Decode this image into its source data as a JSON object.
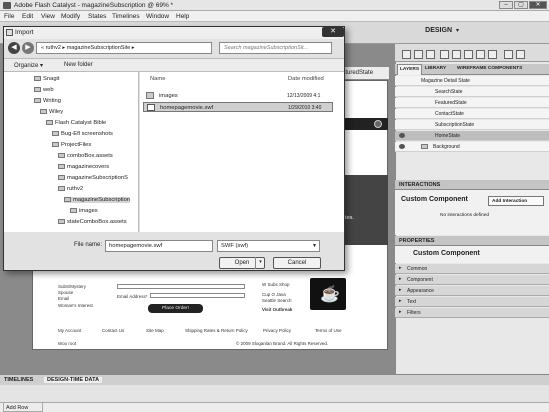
{
  "app": {
    "title": "Adobe Flash Catalyst - magazineSubscription @ 69% *",
    "window_buttons": [
      "–",
      "▢",
      "✕"
    ]
  },
  "menu": [
    "File",
    "Edit",
    "View",
    "Modify",
    "States",
    "Timelines",
    "Window",
    "Help"
  ],
  "toolbar": {
    "workspace": "DESIGN",
    "chevron": "▾"
  },
  "stage": {
    "featured_tab": "FeaturedState",
    "dark_panel_text": "ates.",
    "site": {
      "left_text": [
        "SubS/Mystery",
        "Spouse",
        "Email",
        "Woman's Interest"
      ],
      "email_label": "Email Address*",
      "place_order": "Place Order!",
      "right_text": [
        "W Subs Shop",
        "Cup O Java",
        "Seattle Search",
        "Visit Outbreak"
      ],
      "footer_links": [
        "My Account",
        "Contact Us",
        "Site Map",
        "Shipping Rates & Return Policy",
        "Privacy Policy",
        "Terms of Use"
      ],
      "footer_left": "Woo root",
      "copyright": "© 2009 Sloganlan Brand. All Rights Reserved."
    }
  },
  "timelines": {
    "tab1": "TIMELINES",
    "tab2": "DESIGN-TIME DATA",
    "add_row": "Add Row"
  },
  "layers": {
    "tabs": [
      "LAYERS",
      "LIBRARY",
      "WIREFRAME COMPONENTS"
    ],
    "rows": [
      {
        "label": "Magazine Detail State",
        "indent": 2,
        "eye": false,
        "selected": false
      },
      {
        "label": "SearchState",
        "indent": 3,
        "eye": false,
        "selected": false
      },
      {
        "label": "FeaturedState",
        "indent": 3,
        "eye": false,
        "selected": false
      },
      {
        "label": "ContactState",
        "indent": 3,
        "eye": false,
        "selected": false
      },
      {
        "label": "SubscriptionState",
        "indent": 3,
        "eye": false,
        "selected": false
      },
      {
        "label": "HomeState",
        "indent": 3,
        "eye": true,
        "selected": true
      },
      {
        "label": "Background",
        "indent": 1,
        "eye": true,
        "selected": false
      }
    ]
  },
  "interactions": {
    "header": "INTERACTIONS",
    "title": "Custom Component",
    "add_button": "Add Interaction",
    "empty": "No interactions defined"
  },
  "properties": {
    "header": "PROPERTIES",
    "title": "Custom Component",
    "sections": [
      "Common",
      "Component",
      "Appearance",
      "Text",
      "Filters"
    ]
  },
  "dialog": {
    "title": "Import",
    "close": "✕",
    "back": "◀",
    "forward": "▶",
    "path": "« ruthv2 ▸ magazineSubscriptionSite ▸",
    "search_placeholder": "Search magazineSubscriptionSit...",
    "organize": "Organize ▾",
    "new_folder": "New folder",
    "tree": [
      {
        "label": "Snagit",
        "indent": 1,
        "selected": false
      },
      {
        "label": "web",
        "indent": 1,
        "selected": false
      },
      {
        "label": "Writing",
        "indent": 1,
        "selected": false
      },
      {
        "label": "Wiley",
        "indent": 2,
        "selected": false
      },
      {
        "label": "Flash Catalyst Bible",
        "indent": 3,
        "selected": false
      },
      {
        "label": "Bug-Efl screenshots",
        "indent": 4,
        "selected": false
      },
      {
        "label": "ProjectFiles",
        "indent": 4,
        "selected": false
      },
      {
        "label": "comboBox.assets",
        "indent": 5,
        "selected": false
      },
      {
        "label": "magazinecovers",
        "indent": 5,
        "selected": false
      },
      {
        "label": "magazineSubscriptionS",
        "indent": 5,
        "selected": false
      },
      {
        "label": "ruthv2",
        "indent": 5,
        "selected": false
      },
      {
        "label": "magazineSubscription",
        "indent": 6,
        "selected": true
      },
      {
        "label": "images",
        "indent": 7,
        "selected": false
      },
      {
        "label": "stateComboBox.assets",
        "indent": 5,
        "selected": false
      }
    ],
    "columns": {
      "name": "Name",
      "date": "Date modified"
    },
    "files": [
      {
        "name": "images",
        "date": "12/13/2009 4:1",
        "type": "folder",
        "selected": false
      },
      {
        "name": "homepagemovie.swf",
        "date": "1/29/2010 3:40",
        "type": "swf",
        "selected": true
      }
    ],
    "filename_label": "File name:",
    "filename_value": "homepagemovie.swf",
    "filetype": "SWF (swf)",
    "open": "Open",
    "open_arrow": "▾",
    "cancel": "Cancel"
  }
}
